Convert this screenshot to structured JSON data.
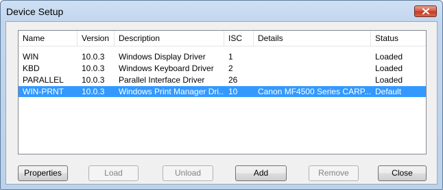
{
  "window": {
    "title": "Device Setup",
    "close_icon": "close-x-icon"
  },
  "list": {
    "columns": [
      "Name",
      "Version",
      "Description",
      "ISC",
      "Details",
      "Status"
    ],
    "rows": [
      {
        "name": "WIN",
        "version": "10.0.3",
        "description": "Windows Display Driver",
        "isc": "1",
        "details": "",
        "status": "Loaded",
        "selected": false
      },
      {
        "name": "KBD",
        "version": "10.0.3",
        "description": "Windows Keyboard Driver",
        "isc": "2",
        "details": "",
        "status": "Loaded",
        "selected": false
      },
      {
        "name": "PARALLEL",
        "version": "10.0.3",
        "description": "Parallel Interface Driver",
        "isc": "26",
        "details": "",
        "status": "Loaded",
        "selected": false
      },
      {
        "name": "WIN-PRNT",
        "version": "10.0.3",
        "description": "Windows Print Manager Dri...",
        "isc": "10",
        "details": "Canon MF4500 Series CARP...",
        "status": "Default",
        "selected": true
      }
    ]
  },
  "buttons": {
    "properties": "Properties",
    "load": "Load",
    "unload": "Unload",
    "add": "Add",
    "remove": "Remove",
    "close": "Close"
  },
  "colors": {
    "selection": "#3399ff"
  }
}
